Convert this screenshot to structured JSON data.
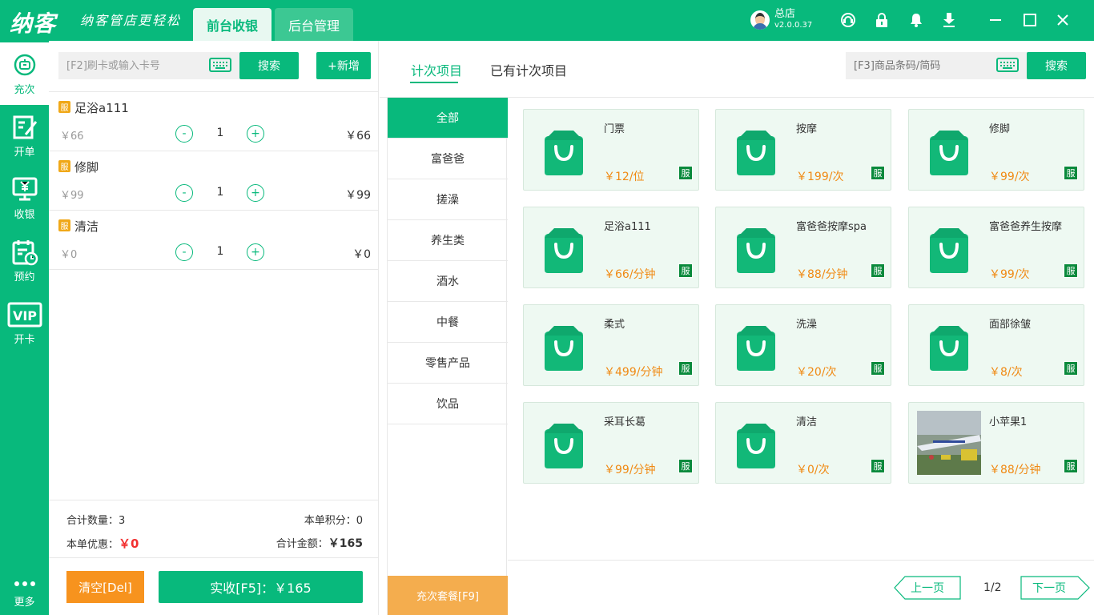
{
  "app": {
    "logo": "纳客",
    "slogan": "纳客管店更轻松",
    "tabs": [
      "前台收银",
      "后台管理"
    ],
    "user_name": "总店",
    "version": "v2.0.0.37"
  },
  "leftnav": [
    "充次",
    "开单",
    "收银",
    "预约",
    "开卡",
    "更多"
  ],
  "cart": {
    "search_placeholder": "[F2]刷卡或输入卡号",
    "search_label": "搜索",
    "add_label": "+新增",
    "badge": "服",
    "items": [
      {
        "name": "足浴a111",
        "price": "￥66",
        "qty": "1",
        "total": "￥66"
      },
      {
        "name": "修脚",
        "price": "￥99",
        "qty": "1",
        "total": "￥99"
      },
      {
        "name": "清洁",
        "price": "￥0",
        "qty": "1",
        "total": "￥0"
      }
    ],
    "minus": "-",
    "plus": "+",
    "summary": {
      "count_label": "合计数量：",
      "count": "3",
      "points_label": "本单积分：",
      "points": "0",
      "discount_label": "本单优惠：",
      "discount": "￥0",
      "total_label": "合计金额：",
      "total": "￥165"
    },
    "clear_label": "清空[Del]",
    "pay_label": "实收[F5]：￥165"
  },
  "right": {
    "tabs": [
      "计次项目",
      "已有计次项目"
    ],
    "search_placeholder": "[F3]商品条码/简码",
    "search_label": "搜索",
    "categories": [
      "全部",
      "富爸爸",
      "搓澡",
      "养生类",
      "酒水",
      "中餐",
      "零售产品",
      "饮品"
    ],
    "package_label": "充次套餐[F9]",
    "badge": "服",
    "products": [
      {
        "name": "门票",
        "price": "￥12/位"
      },
      {
        "name": "按摩",
        "price": "￥199/次"
      },
      {
        "name": "修脚",
        "price": "￥99/次"
      },
      {
        "name": "足浴a111",
        "price": "￥66/分钟"
      },
      {
        "name": "富爸爸按摩spa",
        "price": "￥88/分钟"
      },
      {
        "name": "富爸爸养生按摩",
        "price": "￥99/次"
      },
      {
        "name": "柔式",
        "price": "￥499/分钟"
      },
      {
        "name": "洗澡",
        "price": "￥20/次"
      },
      {
        "name": "面部徐皱",
        "price": "￥8/次"
      },
      {
        "name": "采耳长葛",
        "price": "￥99/分钟"
      },
      {
        "name": "清洁",
        "price": "￥0/次"
      },
      {
        "name": "小苹果1",
        "price": "￥88/分钟"
      }
    ],
    "pagination": {
      "prev": "上一页",
      "page": "1/2",
      "next": "下一页"
    }
  },
  "colors": {
    "primary": "#08b97c",
    "orange": "#f7931e",
    "price": "#f08a14",
    "badge": "#0a8a3c"
  }
}
